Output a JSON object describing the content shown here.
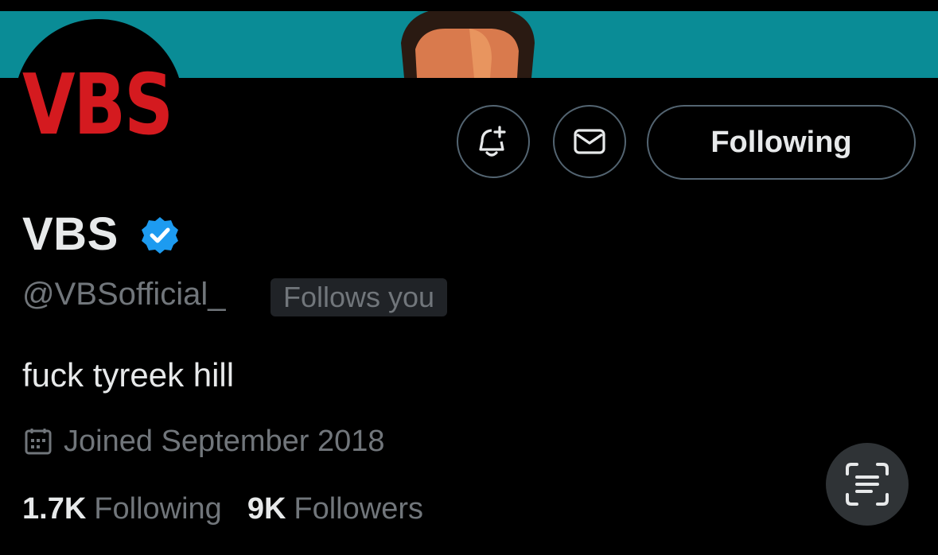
{
  "header": {
    "banner_color": "#0a8c96",
    "avatar_text": "VBS",
    "avatar_text_color": "#d41a1f"
  },
  "actions": {
    "notify_icon": "bell-plus-icon",
    "message_icon": "envelope-icon",
    "follow_button_label": "Following"
  },
  "profile": {
    "display_name": "VBS",
    "verified_icon": "verified-badge-icon",
    "verified_color": "#1d9bf0",
    "handle": "@VBSofficial_",
    "follows_you_label": "Follows you",
    "bio": "fuck tyreek hill",
    "joined_icon": "calendar-icon",
    "joined_text": "Joined September 2018"
  },
  "stats": {
    "following_count": "1.7K",
    "following_label": "Following",
    "followers_count": "9K",
    "followers_label": "Followers"
  },
  "floating": {
    "scan_icon": "text-scan-icon"
  }
}
